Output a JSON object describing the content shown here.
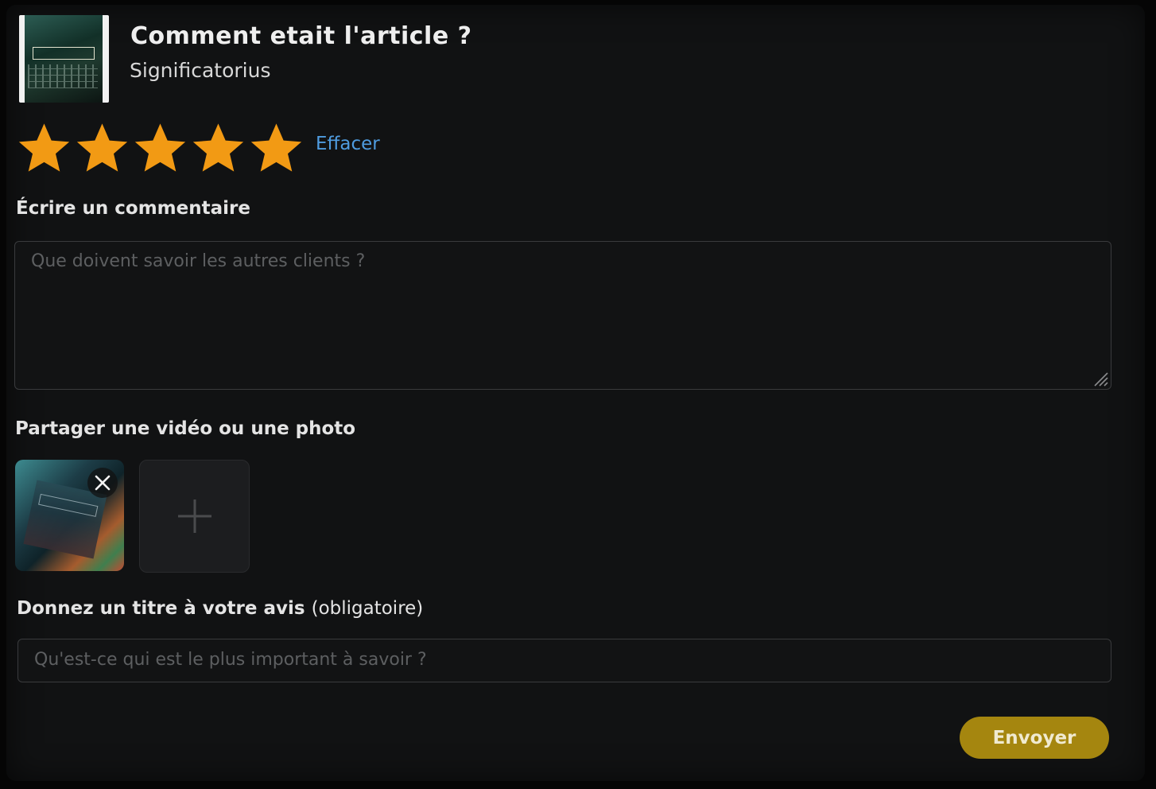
{
  "header": {
    "title": "Comment etait l'article  ?",
    "product_name": "Significatorius"
  },
  "rating": {
    "value": 5,
    "max": 5,
    "clear_label": "Effacer",
    "star_color": "#f29a14"
  },
  "comment": {
    "label": "Écrire un commentaire",
    "placeholder": "Que doivent savoir les autres clients  ?",
    "value": ""
  },
  "media": {
    "label": "Partager une vidéo ou une photo",
    "uploaded_count": 1,
    "remove_icon": "close-icon",
    "add_icon": "plus-icon"
  },
  "review_title": {
    "label": "Donnez un titre à votre avis",
    "label_note": "(obligatoire)",
    "placeholder": "Qu'est-ce qui est le plus important à savoir  ?",
    "value": ""
  },
  "actions": {
    "submit_label": "Envoyer",
    "submit_color": "#a5860f"
  },
  "colors": {
    "background": "#111213",
    "link": "#4f9ce0"
  }
}
